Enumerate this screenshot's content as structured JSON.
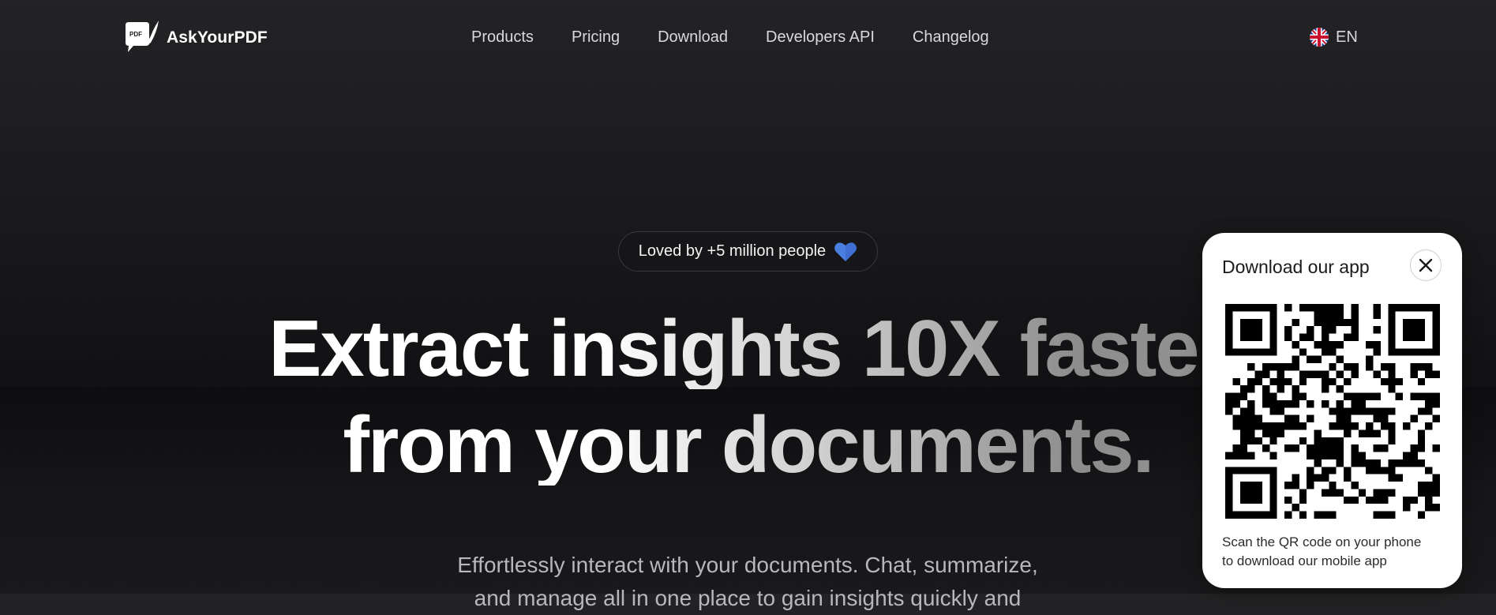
{
  "brand": {
    "name": "AskYourPDF",
    "logo_badge_text": "PDF"
  },
  "nav": {
    "links": [
      {
        "label": "Products"
      },
      {
        "label": "Pricing"
      },
      {
        "label": "Download"
      },
      {
        "label": "Developers API"
      },
      {
        "label": "Changelog"
      }
    ],
    "language": {
      "label": "EN",
      "flag_icon": "uk-flag-icon"
    }
  },
  "hero": {
    "badge": {
      "text": "Loved by +5 million people",
      "icon": "heart-icon",
      "icon_color": "#4a7fe0"
    },
    "headline_line1": "Extract insights 10X faster",
    "headline_line2": "from your documents.",
    "subtitle_line1": "Effortlessly interact with your documents. Chat, summarize,",
    "subtitle_line2": "and manage all in one place to gain insights quickly and"
  },
  "qr_popup": {
    "title": "Download our app",
    "close_icon": "close-icon",
    "qr_icon": "qr-code",
    "caption_line1": "Scan the QR code on your phone",
    "caption_line2": "to download our mobile app"
  },
  "colors": {
    "background": "#1a1a1c",
    "nav_text": "#d9d9dc",
    "subtitle_text": "#b7b7bc",
    "popup_bg": "#ffffff",
    "heart": "#4a7fe0"
  }
}
